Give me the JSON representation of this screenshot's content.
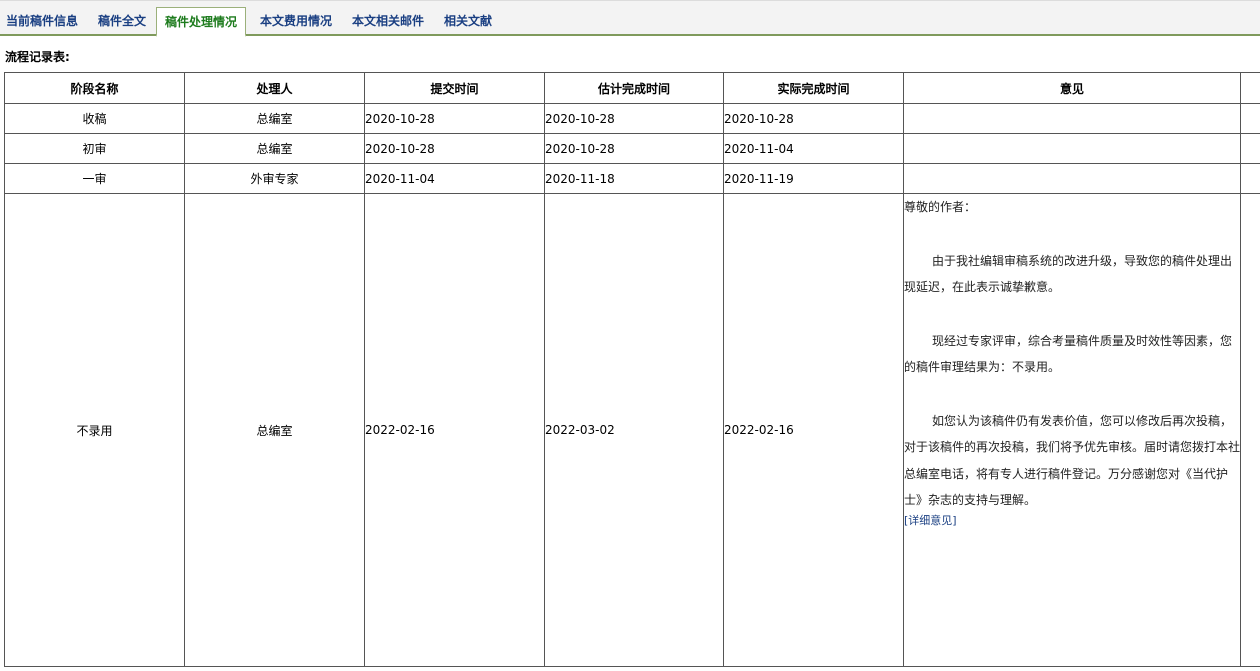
{
  "tabs": [
    {
      "label": "当前稿件信息",
      "active": false
    },
    {
      "label": "稿件全文",
      "active": false
    },
    {
      "label": "稿件处理情况",
      "active": true
    },
    {
      "label": "本文费用情况",
      "active": false
    },
    {
      "label": "本文相关邮件",
      "active": false
    },
    {
      "label": "相关文献",
      "active": false
    }
  ],
  "section_title": "流程记录表:",
  "table": {
    "headers": [
      "阶段名称",
      "处理人",
      "提交时间",
      "估计完成时间",
      "实际完成时间",
      "意见"
    ],
    "rows": [
      {
        "stage": "收稿",
        "handler": "总编室",
        "submitted": "2020-10-28",
        "estimated": "2020-10-28",
        "actual": "2020-10-28",
        "opinion": ""
      },
      {
        "stage": "初审",
        "handler": "总编室",
        "submitted": "2020-10-28",
        "estimated": "2020-10-28",
        "actual": "2020-11-04",
        "opinion": ""
      },
      {
        "stage": "一审",
        "handler": "外审专家",
        "submitted": "2020-11-04",
        "estimated": "2020-11-18",
        "actual": "2020-11-19",
        "opinion": ""
      },
      {
        "stage": "不录用",
        "handler": "总编室",
        "submitted": "2022-02-16",
        "estimated": "2022-03-02",
        "actual": "2022-02-16",
        "opinion_paragraphs": [
          "尊敬的作者：",
          "由于我社编辑审稿系统的改进升级，导致您的稿件处理出现延迟，在此表示诚挚歉意。",
          "现经过专家评审，综合考量稿件质量及时效性等因素，您的稿件审理结果为：不录用。",
          "如您认为该稿件仍有发表价值，您可以修改后再次投稿，对于该稿件的再次投稿，我们将予优先审核。届时请您拨打本社总编室电话，将有专人进行稿件登记。万分感谢您对《当代护士》杂志的支持与理解。"
        ],
        "detail_link": "[详细意见]"
      }
    ]
  }
}
